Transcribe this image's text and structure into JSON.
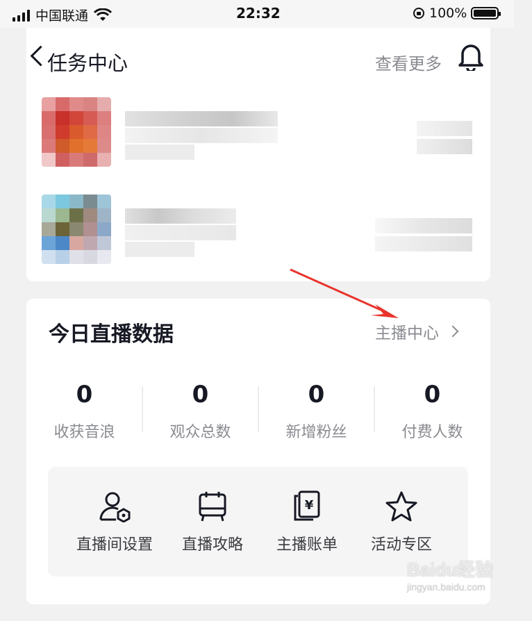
{
  "status_bar": {
    "carrier": "中国联通",
    "time": "22:32",
    "battery": "100%"
  },
  "nav": {
    "title": "任务中心",
    "more": "查看更多"
  },
  "live_data": {
    "title": "今日直播数据",
    "anchor_center": "主播中心",
    "stats": [
      {
        "value": "0",
        "label": "收获音浪"
      },
      {
        "value": "0",
        "label": "观众总数"
      },
      {
        "value": "0",
        "label": "新增粉丝"
      },
      {
        "value": "0",
        "label": "付费人数"
      }
    ],
    "tools": [
      {
        "label": "直播间设置",
        "icon": "user-settings-icon"
      },
      {
        "label": "直播攻略",
        "icon": "guide-book-icon"
      },
      {
        "label": "主播账单",
        "icon": "bill-icon"
      },
      {
        "label": "活动专区",
        "icon": "star-icon"
      }
    ]
  },
  "watermark": {
    "line1": "Baidu经验",
    "line2": "jingyan.baidu.com"
  },
  "colors": {
    "primary_text": "#161823",
    "secondary_text": "#8a8b91",
    "annotation_arrow": "#e8342c"
  }
}
